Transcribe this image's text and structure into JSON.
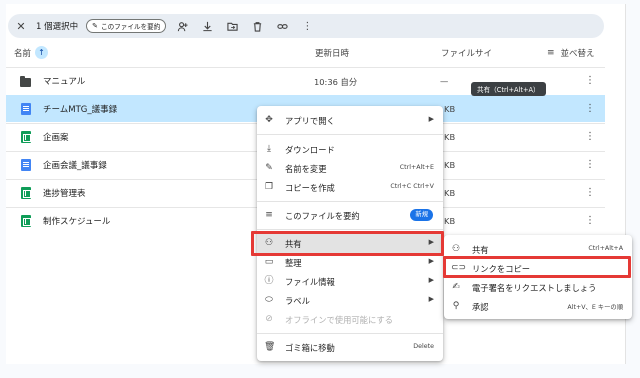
{
  "toolbar": {
    "close": "✕",
    "selection_count": "1 個選択中",
    "summarize_label": "このファイルを要約"
  },
  "header": {
    "name": "名前",
    "modified": "更新日時",
    "size": "ファイルサイ",
    "sort": "並べ替え"
  },
  "rows": [
    {
      "name": "マニュアル",
      "modified": "10:36 自分",
      "size": "—",
      "type": "folder"
    },
    {
      "name": "チームMTG_議事録",
      "modified": "",
      "size": "KB",
      "type": "doc"
    },
    {
      "name": "企画案",
      "modified": "",
      "size": "KB",
      "type": "sheet"
    },
    {
      "name": "企画会議_議事録",
      "modified": "",
      "size": "KB",
      "type": "doc"
    },
    {
      "name": "進捗管理表",
      "modified": "",
      "size": "KB",
      "type": "sheet"
    },
    {
      "name": "制作スケジュール",
      "modified": "",
      "size": "KB",
      "type": "sheet"
    }
  ],
  "tooltip": "共有（Ctrl+Alt+A）",
  "menu": {
    "open_with": "アプリで開く",
    "download": "ダウンロード",
    "rename": "名前を変更",
    "rename_shortcut": "Ctrl+Alt+E",
    "copy": "コピーを作成",
    "copy_shortcut": "Ctrl+C Ctrl+V",
    "summarize": "このファイルを要約",
    "new_badge": "新規",
    "share": "共有",
    "organize": "整理",
    "file_info": "ファイル情報",
    "label": "ラベル",
    "offline": "オフラインで使用可能にする",
    "trash": "ゴミ箱に移動",
    "trash_shortcut": "Delete"
  },
  "submenu": {
    "share": "共有",
    "share_shortcut": "Ctrl+Alt+A",
    "copy_link": "リンクをコピー",
    "esign": "電子署名をリクエストしましょう",
    "approval": "承認",
    "approval_shortcut": "Alt+V、E キーの順"
  },
  "colors": {
    "selected_row": "#c2e7ff",
    "highlight_box": "#e53935",
    "doc": "#4285f4",
    "sheet": "#0f9d58"
  }
}
